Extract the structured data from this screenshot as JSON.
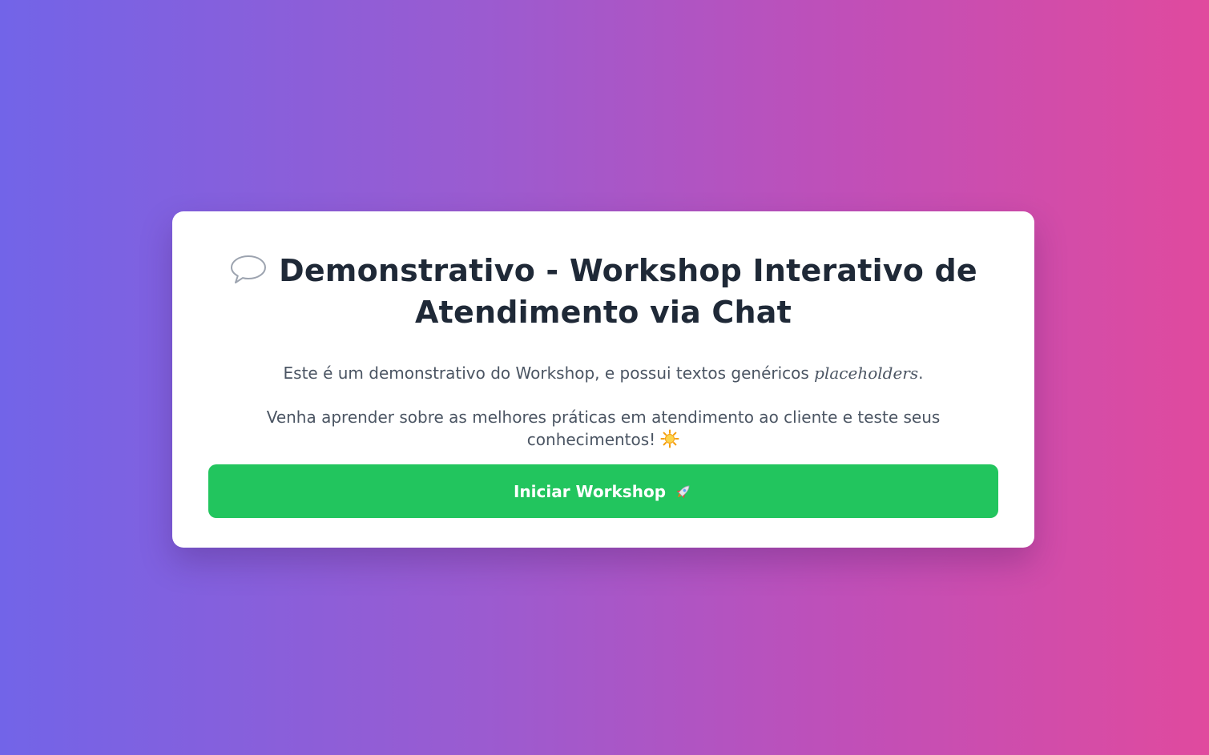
{
  "card": {
    "title_icon": "speech-bubble-icon",
    "title": "Demonstrativo - Workshop Interativo de Atendimento via Chat",
    "intro": {
      "prefix": "Este é um demonstrativo do Workshop, e possui textos genéricos ",
      "emphasis": "placeholders",
      "suffix": "."
    },
    "cta_text": "Venha aprender sobre as melhores práticas em atendimento ao cliente e teste seus conhecimentos!",
    "cta_icon": "sun-icon",
    "start_button": {
      "label": "Iniciar Workshop",
      "icon": "rocket-icon"
    }
  },
  "colors": {
    "gradient_start": "#7264e8",
    "gradient_end": "#e04a9e",
    "card_background": "#ffffff",
    "title_text": "#1f2937",
    "body_text": "#4b5563",
    "button_background": "#22c55e",
    "button_text": "#ffffff"
  }
}
